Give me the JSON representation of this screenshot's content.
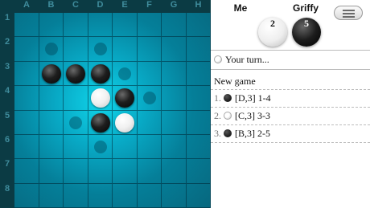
{
  "board": {
    "columns": [
      "A",
      "B",
      "C",
      "D",
      "E",
      "F",
      "G",
      "H"
    ],
    "rows": [
      "1",
      "2",
      "3",
      "4",
      "5",
      "6",
      "7",
      "8"
    ],
    "discs": [
      {
        "cell": "B3",
        "color": "black"
      },
      {
        "cell": "C3",
        "color": "black"
      },
      {
        "cell": "D3",
        "color": "black"
      },
      {
        "cell": "D4",
        "color": "white"
      },
      {
        "cell": "E4",
        "color": "black"
      },
      {
        "cell": "D5",
        "color": "black"
      },
      {
        "cell": "E5",
        "color": "white"
      }
    ],
    "hints": [
      "B2",
      "D2",
      "E3",
      "F4",
      "C5",
      "D6"
    ]
  },
  "players": {
    "me": {
      "name": "Me",
      "score": "2",
      "color": "white"
    },
    "opponent": {
      "name": "Griffy",
      "score": "5",
      "color": "black"
    }
  },
  "menu_icon": "hamburger-icon",
  "status": {
    "text": "Your turn...",
    "icon": "white-disc"
  },
  "history": {
    "title": "New game",
    "moves": [
      {
        "num": "1.",
        "color": "black",
        "text": "[D,3] 1-4"
      },
      {
        "num": "2.",
        "color": "white",
        "text": "[C,3] 3-3"
      },
      {
        "num": "3.",
        "color": "black",
        "text": "[B,3] 2-5"
      }
    ]
  },
  "colors": {
    "board_glow": "#10d4ea",
    "board_edge": "#06677e",
    "frame": "#0b3b44"
  }
}
